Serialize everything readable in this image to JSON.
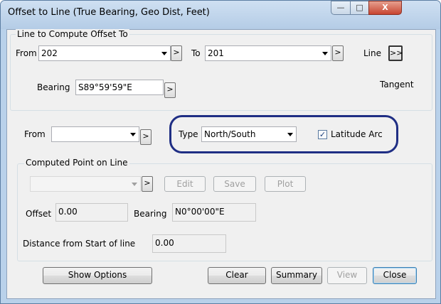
{
  "window": {
    "title": "Offset to Line (True Bearing, Geo Dist, Feet)",
    "buttons": {
      "minimize": "—",
      "maximize": "□",
      "close": "X"
    }
  },
  "line_group": {
    "legend": "Line to Compute Offset To",
    "from_label": "From",
    "from_value": "202",
    "to_label": "To",
    "to_value": "201",
    "line_label": "Line",
    "line_button": ">>",
    "bearing_label": "Bearing",
    "bearing_value": "S89°59'59\"E",
    "tangent_label": "Tangent",
    "small_button": ">"
  },
  "offset_from": {
    "label": "From",
    "value": ""
  },
  "type": {
    "label": "Type",
    "value": "North/South"
  },
  "latitude_arc": {
    "label": "Latitude Arc",
    "checked": true,
    "check_glyph": "✓"
  },
  "computed_group": {
    "legend": "Computed Point on Line",
    "point_value": "",
    "edit_label": "Edit",
    "save_label": "Save",
    "plot_label": "Plot",
    "offset_label": "Offset",
    "offset_value": "0.00",
    "bearing_label": "Bearing",
    "bearing_value": "N0°00'00\"E",
    "distance_label": "Distance from Start of line",
    "distance_value": "0.00"
  },
  "footer": {
    "show_options": "Show Options",
    "clear": "Clear",
    "summary": "Summary",
    "view": "View",
    "close": "Close"
  },
  "colors": {
    "highlight": "#1f2e84",
    "caption": "#b9d1ea",
    "close_button": "#c74531"
  }
}
